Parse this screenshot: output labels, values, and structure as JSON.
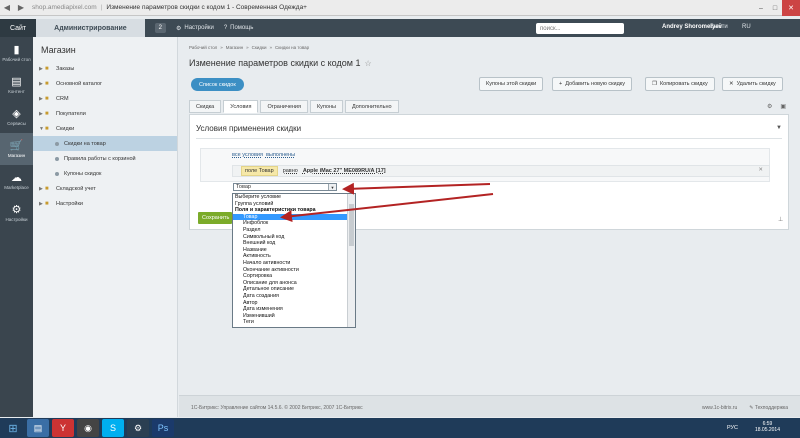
{
  "browser": {
    "url": "shop.amediapixel.com",
    "title": "Изменение параметров скидки с кодом 1 - Современная Одежда+"
  },
  "header": {
    "site_tab": "Сайт",
    "admin_tab": "Администрирование",
    "badge": "2",
    "settings": "Настройки",
    "help": "Помощь",
    "search_placeholder": "поиск...",
    "user": "Andrey Shoromelyev",
    "exit": "Выйти",
    "lang": "RU"
  },
  "icon_sidebar": [
    {
      "label": "Рабочий стол",
      "icon": "desktop-icon",
      "glyph": "▮"
    },
    {
      "label": "Контент",
      "icon": "content-icon",
      "glyph": "▤"
    },
    {
      "label": "Сервисы",
      "icon": "services-icon",
      "glyph": "◈"
    },
    {
      "label": "Магазин",
      "icon": "shop-icon",
      "glyph": "🛒"
    },
    {
      "label": "Marketplace",
      "icon": "cloud-icon",
      "glyph": "☁"
    },
    {
      "label": "Настройки",
      "icon": "settings-icon",
      "glyph": "⚙"
    }
  ],
  "tree": {
    "title": "Магазин",
    "items": [
      {
        "label": "Заказы",
        "type": "top"
      },
      {
        "label": "Основной каталог",
        "type": "top"
      },
      {
        "label": "CRM",
        "type": "top"
      },
      {
        "label": "Покупатели",
        "type": "top"
      },
      {
        "label": "Скидки",
        "type": "top-open"
      },
      {
        "label": "Скидки на товар",
        "type": "sub-selected"
      },
      {
        "label": "Правила работы с корзиной",
        "type": "sub"
      },
      {
        "label": "Купоны скидок",
        "type": "sub"
      },
      {
        "label": "Складской учет",
        "type": "top"
      },
      {
        "label": "Настройки",
        "type": "top"
      }
    ]
  },
  "main": {
    "breadcrumb": [
      "Рабочий стол",
      "»",
      "Магазин",
      "»",
      "Скидки",
      "»",
      "Скидки на товар"
    ],
    "heading": "Изменение параметров скидки с кодом 1",
    "btn_list": "Список скидок",
    "btn_coupons": "Купоны этой скидки",
    "btn_add": "Добавить новую скидку",
    "btn_copy": "Копировать скидку",
    "btn_delete": "Удалить скидку",
    "tabs": [
      "Скидка",
      "Условия",
      "Ограничения",
      "Купоны",
      "Дополнительно"
    ],
    "active_tab": 1,
    "panel_title": "Условия применения скидки",
    "cond_all": "все условия",
    "cond_done": "выполнены",
    "cond_field": "поле Товар",
    "cond_op": "равно",
    "cond_value": "Apple iMac 27\" ME089RU/A [17]",
    "select_value": "Товар",
    "save_label": "Сохранить"
  },
  "dropdown": [
    {
      "label": "Выберите условие",
      "kind": "plain"
    },
    {
      "label": "Группа условий",
      "kind": "plain"
    },
    {
      "label": "Поля и характеристики товара",
      "kind": "group"
    },
    {
      "label": "Товар",
      "kind": "hl"
    },
    {
      "label": "Инфоблок",
      "kind": "indent"
    },
    {
      "label": "Раздел",
      "kind": "indent"
    },
    {
      "label": "Символьный код",
      "kind": "indent"
    },
    {
      "label": "Внешний код",
      "kind": "indent"
    },
    {
      "label": "Название",
      "kind": "indent"
    },
    {
      "label": "Активность",
      "kind": "indent"
    },
    {
      "label": "Начало активности",
      "kind": "indent"
    },
    {
      "label": "Окончание активности",
      "kind": "indent"
    },
    {
      "label": "Сортировка",
      "kind": "indent"
    },
    {
      "label": "Описание для анонса",
      "kind": "indent"
    },
    {
      "label": "Детальное описание",
      "kind": "indent"
    },
    {
      "label": "Дата создания",
      "kind": "indent"
    },
    {
      "label": "Автор",
      "kind": "indent"
    },
    {
      "label": "Дата изменения",
      "kind": "indent"
    },
    {
      "label": "Изменивший",
      "kind": "indent"
    },
    {
      "label": "Теги",
      "kind": "indent"
    }
  ],
  "footer": {
    "left": "1С-Битрикс: Управление сайтом 14.5.6. © 2002 Битрикс, 2007 1С-Битрикс",
    "site": "www.1c-bitrix.ru",
    "support": "Техподдержка"
  },
  "taskbar": {
    "lang": "РУС",
    "time": "6:59",
    "date": "18.05.2014"
  }
}
